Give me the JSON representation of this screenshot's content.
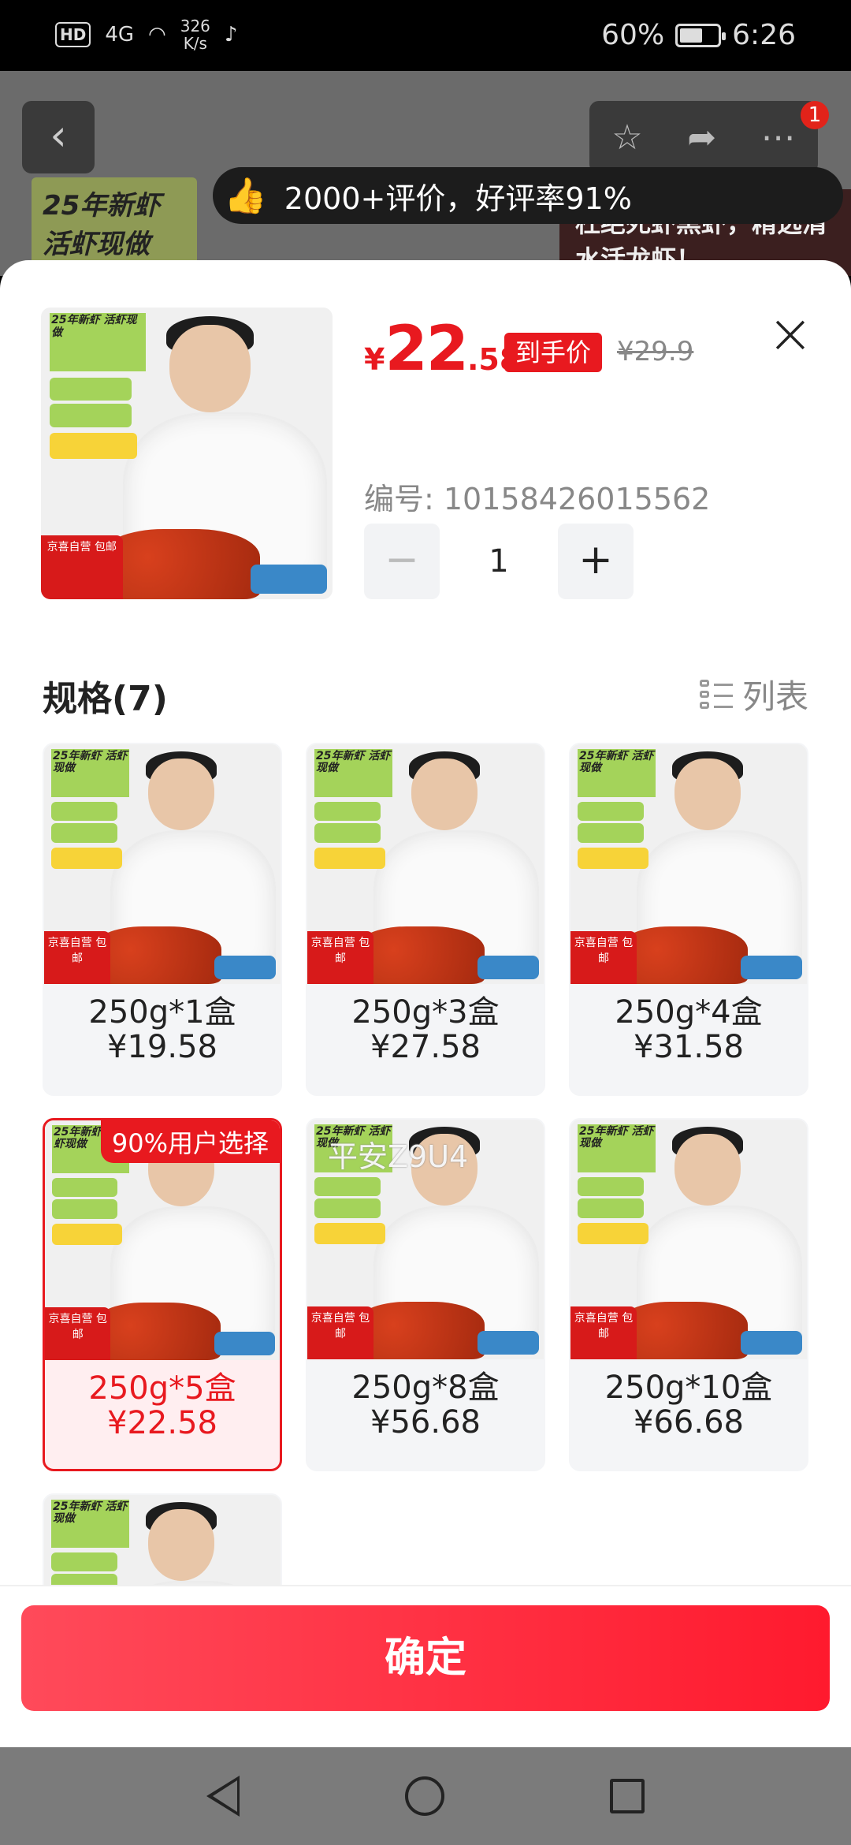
{
  "status_bar": {
    "hd": "HD",
    "signal": "4G",
    "speed_top": "326",
    "speed_bottom": "K/s",
    "battery": "60%",
    "battery_level": 0.6,
    "time": "6:26"
  },
  "background": {
    "banner_left": "25年新虾 活虾现做",
    "banner_right": "杜绝死虾黑虾，精选清水活龙虾！",
    "review_toast": "2000+评价，好评率91%",
    "notification_count": "1"
  },
  "product": {
    "currency": "¥",
    "price_int": "22",
    "price_dec": ".58",
    "price_tag": "到手价",
    "original_price": "¥29.9",
    "sku_label": "编号: 10158426015562",
    "quantity": "1",
    "image_tag": "25年新虾 活虾现做",
    "jd_tag": "京喜自营 包邮"
  },
  "spec": {
    "title": "规格(7)",
    "list_toggle": "列表",
    "watermark": "平安Z9U4",
    "items": [
      {
        "name": "250g*1盒",
        "price": "¥19.58"
      },
      {
        "name": "250g*3盒",
        "price": "¥27.58"
      },
      {
        "name": "250g*4盒",
        "price": "¥31.58"
      },
      {
        "name": "250g*5盒",
        "price": "¥22.58",
        "badge": "90%用户选择",
        "selected": true
      },
      {
        "name": "250g*8盒",
        "price": "¥56.68"
      },
      {
        "name": "250g*10盒",
        "price": "¥66.68"
      },
      {
        "name": "",
        "price": ""
      }
    ]
  },
  "confirm_label": "确定",
  "colors": {
    "accent": "#e8191f",
    "button": "#ff1a2e",
    "card_bg": "#f4f5f7",
    "selected_bg": "#ffeef0"
  }
}
